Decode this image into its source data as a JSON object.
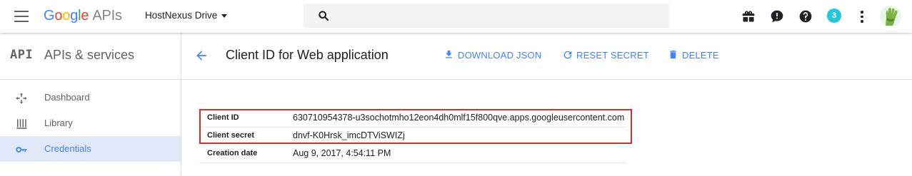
{
  "topbar": {
    "logo": {
      "g1": "G",
      "g2": "o",
      "g3": "o",
      "g4": "g",
      "g5": "l",
      "g6": "e",
      "apis": "APIs"
    },
    "project_name": "HostNexus Drive",
    "search_placeholder": "",
    "notification_count": "3"
  },
  "sidebar": {
    "api_badge": "API",
    "title": "APIs & services",
    "items": [
      {
        "label": "Dashboard",
        "icon": "dashboard-icon"
      },
      {
        "label": "Library",
        "icon": "library-icon"
      },
      {
        "label": "Credentials",
        "icon": "key-icon",
        "active": true
      }
    ]
  },
  "main": {
    "title": "Client ID for Web application",
    "actions": [
      {
        "label": "DOWNLOAD JSON",
        "icon": "download-icon"
      },
      {
        "label": "RESET SECRET",
        "icon": "refresh-icon"
      },
      {
        "label": "DELETE",
        "icon": "trash-icon"
      }
    ],
    "details": [
      {
        "key": "Client ID",
        "value": "630710954378-u3sochotmho12eon4dh0mlf15f800qve.apps.googleusercontent.com"
      },
      {
        "key": "Client secret",
        "value": "dnvf-K0Hrsk_imcDTViSWIZj"
      },
      {
        "key": "Creation date",
        "value": "Aug 9, 2017, 4:54:11 PM"
      }
    ]
  },
  "colors": {
    "accent": "#4285f4",
    "highlight_border": "#d32f2f",
    "active_bg": "#e1e9f8"
  }
}
